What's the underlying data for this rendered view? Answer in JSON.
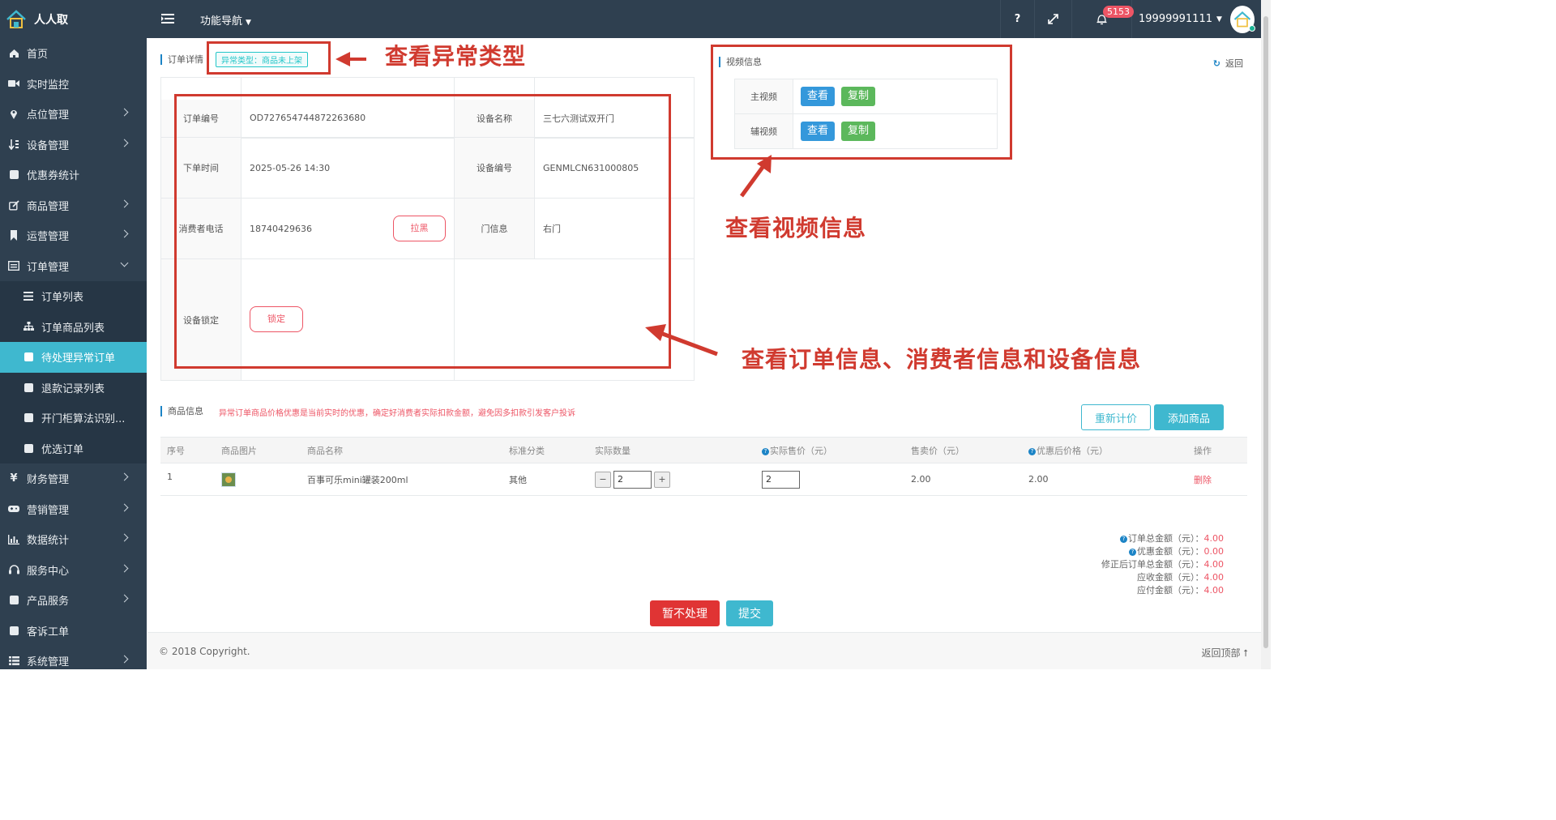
{
  "app": {
    "name": "人人取",
    "nav_menu": "功能导航"
  },
  "header": {
    "help": "?",
    "notification_count": "5153",
    "user_phone": "19999991111"
  },
  "sidebar": {
    "items": [
      {
        "label": "首页"
      },
      {
        "label": "实时监控"
      },
      {
        "label": "点位管理"
      },
      {
        "label": "设备管理"
      },
      {
        "label": "优惠券统计"
      },
      {
        "label": "商品管理"
      },
      {
        "label": "运营管理"
      },
      {
        "label": "订单管理"
      },
      {
        "label": "订单列表"
      },
      {
        "label": "订单商品列表"
      },
      {
        "label": "待处理异常订单"
      },
      {
        "label": "退款记录列表"
      },
      {
        "label": "开门柜算法识别..."
      },
      {
        "label": "优选订单"
      },
      {
        "label": "财务管理"
      },
      {
        "label": "营销管理"
      },
      {
        "label": "数据统计"
      },
      {
        "label": "服务中心"
      },
      {
        "label": "产品服务"
      },
      {
        "label": "客诉工单"
      },
      {
        "label": "系统管理"
      }
    ]
  },
  "order": {
    "section_title": "订单详情",
    "abnormal_tag": "异常类型：商品未上架",
    "back": "返回",
    "fields": {
      "order_no_label": "订单编号",
      "order_no": "OD727654744872263680",
      "device_name_label": "设备名称",
      "device_name": "三七六测试双开门",
      "order_time_label": "下单时间",
      "order_time": "2025-05-26 14:30",
      "device_no_label": "设备编号",
      "device_no": "GENMLCN631000805",
      "phone_label": "消费者电话",
      "phone": "18740429636",
      "blacklist_button": "拉黑",
      "door_label": "门信息",
      "door": "右门",
      "lock_label": "设备锁定",
      "lock_button": "锁定"
    }
  },
  "video": {
    "section_title": "视频信息",
    "rows": [
      {
        "label": "主视频",
        "view": "查看",
        "copy": "复制"
      },
      {
        "label": "辅视频",
        "view": "查看",
        "copy": "复制"
      }
    ]
  },
  "products": {
    "section_title": "商品信息",
    "note": "异常订单商品价格优惠是当前实时的优惠，确定好消费者实际扣款金额，避免因多扣款引发客户投诉",
    "recalc_button": "重新计价",
    "add_button": "添加商品",
    "columns": [
      "序号",
      "商品图片",
      "商品名称",
      "标准分类",
      "实际数量",
      "实际售价（元）",
      "售卖价（元）",
      "优惠后价格（元）",
      "操作"
    ],
    "rows": [
      {
        "index": "1",
        "name": "百事可乐mini罐装200ml",
        "category": "其他",
        "qty": "2",
        "actual_price": "2",
        "sale_price": "2.00",
        "discount_price": "2.00",
        "action": "删除"
      }
    ]
  },
  "totals": {
    "order_total_label": "订单总金额（元）：",
    "order_total": "4.00",
    "discount_label": "优惠金额（元）：",
    "discount": "0.00",
    "corrected_label": "修正后订单总金额（元）：",
    "corrected": "4.00",
    "receivable_label": "应收金额（元）：",
    "receivable": "4.00",
    "payable_label": "应付金额（元）：",
    "payable": "4.00"
  },
  "actions": {
    "hold": "暂不处理",
    "submit": "提交"
  },
  "footer": {
    "copyright": "© 2018 Copyright.",
    "back_to_top": "返回顶部"
  },
  "annotations": {
    "abnormal_type": "查看异常类型",
    "video_info": "查看视频信息",
    "order_info": "查看订单信息、消费者信息和设备信息"
  },
  "colors": {
    "sidebar_bg": "#2f4050",
    "active": "#3fb8cf",
    "primary": "#1c84c6",
    "success": "#1ab394",
    "danger": "#ed5565",
    "annotation": "#d03a2f"
  }
}
